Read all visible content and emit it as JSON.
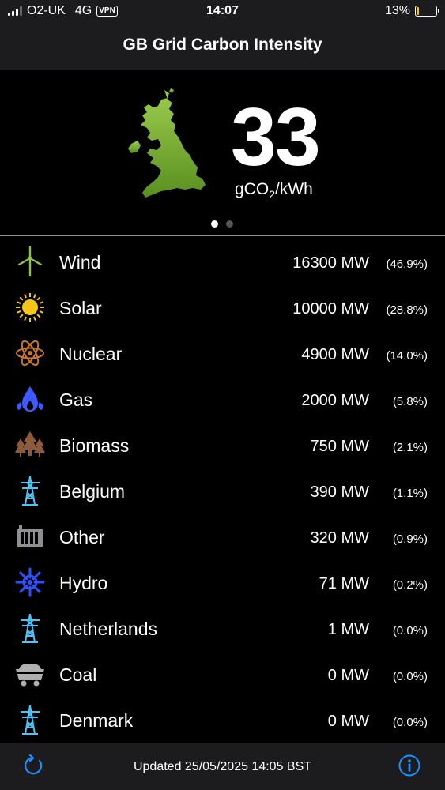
{
  "status_bar": {
    "carrier": "O2-UK",
    "network": "4G",
    "vpn": "VPN",
    "time": "14:07",
    "battery": "13%",
    "battery_level": 0.13
  },
  "header": {
    "title": "GB Grid Carbon Intensity"
  },
  "hero": {
    "intensity": "33",
    "unit_prefix": "gCO",
    "unit_sub": "2",
    "unit_suffix": "/kWh",
    "page_count": 2,
    "active_page": 1,
    "map_color": "#8bc34a"
  },
  "sources": [
    {
      "name": "Wind",
      "mw": "16300 MW",
      "pct": "(46.9%)",
      "icon": "wind-turbine-icon"
    },
    {
      "name": "Solar",
      "mw": "10000 MW",
      "pct": "(28.8%)",
      "icon": "sun-icon"
    },
    {
      "name": "Nuclear",
      "mw": "4900 MW",
      "pct": "(14.0%)",
      "icon": "atom-icon"
    },
    {
      "name": "Gas",
      "mw": "2000 MW",
      "pct": "(5.8%)",
      "icon": "flame-icon"
    },
    {
      "name": "Biomass",
      "mw": "750 MW",
      "pct": "(2.1%)",
      "icon": "trees-icon"
    },
    {
      "name": "Belgium",
      "mw": "390 MW",
      "pct": "(1.1%)",
      "icon": "pylon-icon"
    },
    {
      "name": "Other",
      "mw": "320 MW",
      "pct": "(0.9%)",
      "icon": "factory-icon"
    },
    {
      "name": "Hydro",
      "mw": "71 MW",
      "pct": "(0.2%)",
      "icon": "water-wheel-icon"
    },
    {
      "name": "Netherlands",
      "mw": "1 MW",
      "pct": "(0.0%)",
      "icon": "pylon-icon"
    },
    {
      "name": "Coal",
      "mw": "0 MW",
      "pct": "(0.0%)",
      "icon": "coal-cart-icon"
    },
    {
      "name": "Denmark",
      "mw": "0 MW",
      "pct": "(0.0%)",
      "icon": "pylon-icon"
    }
  ],
  "footer": {
    "updated": "Updated 25/05/2025 14:05 BST",
    "refresh_icon": "refresh-icon",
    "info_icon": "info-icon",
    "accent": "#1e90ff"
  },
  "colors": {
    "wind": "#8bc34a",
    "solar": "#f5c518",
    "nuclear": "#c8752a",
    "gas": "#3d5afe",
    "biomass": "#8d5a3b",
    "interconnect": "#4fc3f7",
    "other": "#8e8e93",
    "hydro": "#304ffe",
    "coal": "#b0b0b0"
  }
}
